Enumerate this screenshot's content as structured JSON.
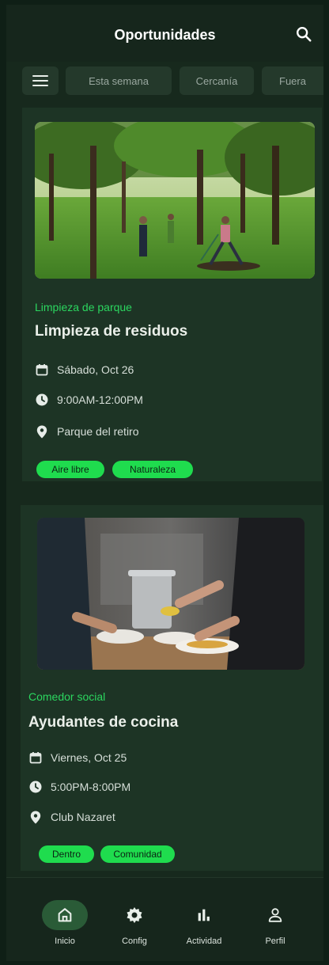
{
  "header": {
    "title": "Oportunidades",
    "search_icon": "search-icon"
  },
  "filters": {
    "menu_icon": "menu-icon",
    "chips": [
      "Esta semana",
      "Cercanía",
      "Fuera"
    ]
  },
  "cards": [
    {
      "category": "Limpieza de parque",
      "title": "Limpieza de residuos",
      "date": "Sábado, Oct 26",
      "time": "9:00AM-12:00PM",
      "location": "Parque del retiro",
      "tags": [
        "Aire libre",
        "Naturaleza"
      ]
    },
    {
      "category": "Comedor social",
      "title": "Ayudantes de cocina",
      "date": "Viernes, Oct 25",
      "time": "5:00PM-8:00PM",
      "location": "Club Nazaret",
      "tags": [
        "Dentro",
        "Comunidad"
      ]
    }
  ],
  "nav": {
    "active": "Inicio",
    "items": [
      {
        "label": "Inicio",
        "icon": "home-icon"
      },
      {
        "label": "Config",
        "icon": "gear-icon"
      },
      {
        "label": "Actividad",
        "icon": "bar-chart-icon"
      },
      {
        "label": "Perfil",
        "icon": "person-icon"
      }
    ]
  },
  "colors": {
    "background": "#17291d",
    "card": "#1d3425",
    "accent": "#2bd65f",
    "tag": "#1fdc4e",
    "nav_active": "#2a5b37"
  }
}
